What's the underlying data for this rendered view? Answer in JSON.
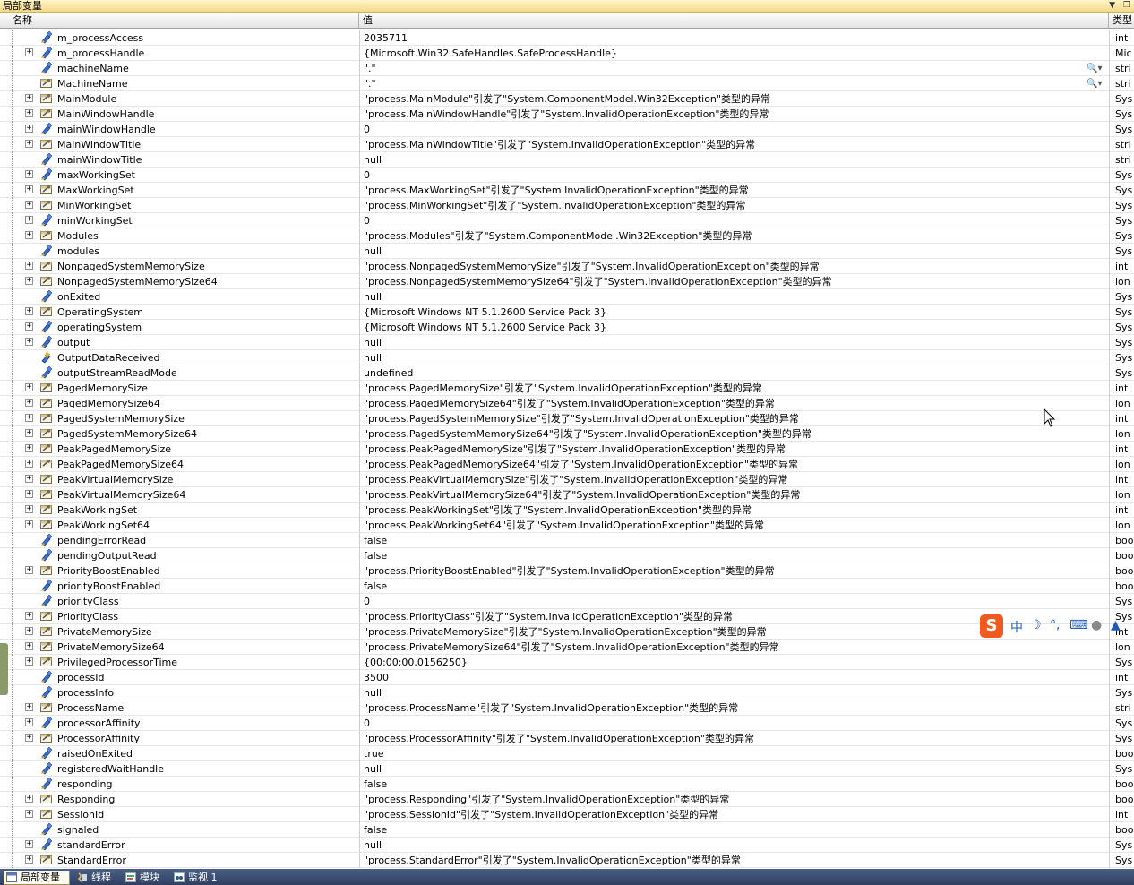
{
  "panel": {
    "title": "局部变量"
  },
  "columns": {
    "name": "名称",
    "value": "值",
    "type": "类型"
  },
  "rows": [
    {
      "name": "m_processAccess",
      "value": "2035711",
      "type": "int",
      "exp": false,
      "icon": "field"
    },
    {
      "name": "m_processHandle",
      "value": "{Microsoft.Win32.SafeHandles.SafeProcessHandle}",
      "type": "Mic",
      "exp": true,
      "icon": "field"
    },
    {
      "name": "machineName",
      "value": "\".\"",
      "type": "stri",
      "exp": false,
      "icon": "field",
      "mag": true
    },
    {
      "name": "MachineName",
      "value": "\".\"",
      "type": "stri",
      "exp": false,
      "icon": "prop",
      "mag": true
    },
    {
      "name": "MainModule",
      "value": "\"process.MainModule\"引发了\"System.ComponentModel.Win32Exception\"类型的异常",
      "type": "Sys",
      "exp": true,
      "icon": "prop"
    },
    {
      "name": "MainWindowHandle",
      "value": "\"process.MainWindowHandle\"引发了\"System.InvalidOperationException\"类型的异常",
      "type": "Sys",
      "exp": true,
      "icon": "prop"
    },
    {
      "name": "mainWindowHandle",
      "value": "0",
      "type": "Sys",
      "exp": true,
      "icon": "field"
    },
    {
      "name": "MainWindowTitle",
      "value": "\"process.MainWindowTitle\"引发了\"System.InvalidOperationException\"类型的异常",
      "type": "stri",
      "exp": true,
      "icon": "prop"
    },
    {
      "name": "mainWindowTitle",
      "value": "null",
      "type": "stri",
      "exp": false,
      "icon": "field"
    },
    {
      "name": "maxWorkingSet",
      "value": "0",
      "type": "Sys",
      "exp": true,
      "icon": "field"
    },
    {
      "name": "MaxWorkingSet",
      "value": "\"process.MaxWorkingSet\"引发了\"System.InvalidOperationException\"类型的异常",
      "type": "Sys",
      "exp": true,
      "icon": "prop"
    },
    {
      "name": "MinWorkingSet",
      "value": "\"process.MinWorkingSet\"引发了\"System.InvalidOperationException\"类型的异常",
      "type": "Sys",
      "exp": true,
      "icon": "prop"
    },
    {
      "name": "minWorkingSet",
      "value": "0",
      "type": "Sys",
      "exp": true,
      "icon": "field"
    },
    {
      "name": "Modules",
      "value": "\"process.Modules\"引发了\"System.ComponentModel.Win32Exception\"类型的异常",
      "type": "Sys",
      "exp": true,
      "icon": "prop"
    },
    {
      "name": "modules",
      "value": "null",
      "type": "Sys",
      "exp": false,
      "icon": "field"
    },
    {
      "name": "NonpagedSystemMemorySize",
      "value": "\"process.NonpagedSystemMemorySize\"引发了\"System.InvalidOperationException\"类型的异常",
      "type": "int",
      "exp": true,
      "icon": "prop"
    },
    {
      "name": "NonpagedSystemMemorySize64",
      "value": "\"process.NonpagedSystemMemorySize64\"引发了\"System.InvalidOperationException\"类型的异常",
      "type": "lon",
      "exp": true,
      "icon": "prop"
    },
    {
      "name": "onExited",
      "value": "null",
      "type": "Sys",
      "exp": false,
      "icon": "field"
    },
    {
      "name": "OperatingSystem",
      "value": "{Microsoft Windows NT 5.1.2600 Service Pack 3}",
      "type": "Sys",
      "exp": true,
      "icon": "prop"
    },
    {
      "name": "operatingSystem",
      "value": "{Microsoft Windows NT 5.1.2600 Service Pack 3}",
      "type": "Sys",
      "exp": true,
      "icon": "field"
    },
    {
      "name": "output",
      "value": "null",
      "type": "Sys",
      "exp": true,
      "icon": "field"
    },
    {
      "name": "OutputDataReceived",
      "value": "null",
      "type": "Sys",
      "exp": false,
      "icon": "event"
    },
    {
      "name": "outputStreamReadMode",
      "value": "undefined",
      "type": "Sys",
      "exp": false,
      "icon": "field"
    },
    {
      "name": "PagedMemorySize",
      "value": "\"process.PagedMemorySize\"引发了\"System.InvalidOperationException\"类型的异常",
      "type": "int",
      "exp": true,
      "icon": "prop"
    },
    {
      "name": "PagedMemorySize64",
      "value": "\"process.PagedMemorySize64\"引发了\"System.InvalidOperationException\"类型的异常",
      "type": "lon",
      "exp": true,
      "icon": "prop"
    },
    {
      "name": "PagedSystemMemorySize",
      "value": "\"process.PagedSystemMemorySize\"引发了\"System.InvalidOperationException\"类型的异常",
      "type": "int",
      "exp": true,
      "icon": "prop"
    },
    {
      "name": "PagedSystemMemorySize64",
      "value": "\"process.PagedSystemMemorySize64\"引发了\"System.InvalidOperationException\"类型的异常",
      "type": "lon",
      "exp": true,
      "icon": "prop"
    },
    {
      "name": "PeakPagedMemorySize",
      "value": "\"process.PeakPagedMemorySize\"引发了\"System.InvalidOperationException\"类型的异常",
      "type": "int",
      "exp": true,
      "icon": "prop"
    },
    {
      "name": "PeakPagedMemorySize64",
      "value": "\"process.PeakPagedMemorySize64\"引发了\"System.InvalidOperationException\"类型的异常",
      "type": "lon",
      "exp": true,
      "icon": "prop"
    },
    {
      "name": "PeakVirtualMemorySize",
      "value": "\"process.PeakVirtualMemorySize\"引发了\"System.InvalidOperationException\"类型的异常",
      "type": "int",
      "exp": true,
      "icon": "prop"
    },
    {
      "name": "PeakVirtualMemorySize64",
      "value": "\"process.PeakVirtualMemorySize64\"引发了\"System.InvalidOperationException\"类型的异常",
      "type": "lon",
      "exp": true,
      "icon": "prop"
    },
    {
      "name": "PeakWorkingSet",
      "value": "\"process.PeakWorkingSet\"引发了\"System.InvalidOperationException\"类型的异常",
      "type": "int",
      "exp": true,
      "icon": "prop"
    },
    {
      "name": "PeakWorkingSet64",
      "value": "\"process.PeakWorkingSet64\"引发了\"System.InvalidOperationException\"类型的异常",
      "type": "lon",
      "exp": true,
      "icon": "prop"
    },
    {
      "name": "pendingErrorRead",
      "value": "false",
      "type": "boo",
      "exp": false,
      "icon": "field"
    },
    {
      "name": "pendingOutputRead",
      "value": "false",
      "type": "boo",
      "exp": false,
      "icon": "field"
    },
    {
      "name": "PriorityBoostEnabled",
      "value": "\"process.PriorityBoostEnabled\"引发了\"System.InvalidOperationException\"类型的异常",
      "type": "boo",
      "exp": true,
      "icon": "prop"
    },
    {
      "name": "priorityBoostEnabled",
      "value": "false",
      "type": "boo",
      "exp": false,
      "icon": "field"
    },
    {
      "name": "priorityClass",
      "value": "0",
      "type": "Sys",
      "exp": false,
      "icon": "field"
    },
    {
      "name": "PriorityClass",
      "value": "\"process.PriorityClass\"引发了\"System.InvalidOperationException\"类型的异常",
      "type": "Sys",
      "exp": true,
      "icon": "prop"
    },
    {
      "name": "PrivateMemorySize",
      "value": "\"process.PrivateMemorySize\"引发了\"System.InvalidOperationException\"类型的异常",
      "type": "int",
      "exp": true,
      "icon": "prop"
    },
    {
      "name": "PrivateMemorySize64",
      "value": "\"process.PrivateMemorySize64\"引发了\"System.InvalidOperationException\"类型的异常",
      "type": "lon",
      "exp": true,
      "icon": "prop"
    },
    {
      "name": "PrivilegedProcessorTime",
      "value": "{00:00:00.0156250}",
      "type": "Sys",
      "exp": true,
      "icon": "prop"
    },
    {
      "name": "processId",
      "value": "3500",
      "type": "int",
      "exp": false,
      "icon": "field"
    },
    {
      "name": "processInfo",
      "value": "null",
      "type": "Sys",
      "exp": false,
      "icon": "field"
    },
    {
      "name": "ProcessName",
      "value": "\"process.ProcessName\"引发了\"System.InvalidOperationException\"类型的异常",
      "type": "stri",
      "exp": true,
      "icon": "prop"
    },
    {
      "name": "processorAffinity",
      "value": "0",
      "type": "Sys",
      "exp": true,
      "icon": "field"
    },
    {
      "name": "ProcessorAffinity",
      "value": "\"process.ProcessorAffinity\"引发了\"System.InvalidOperationException\"类型的异常",
      "type": "Sys",
      "exp": true,
      "icon": "prop"
    },
    {
      "name": "raisedOnExited",
      "value": "true",
      "type": "boo",
      "exp": false,
      "icon": "field"
    },
    {
      "name": "registeredWaitHandle",
      "value": "null",
      "type": "Sys",
      "exp": false,
      "icon": "field"
    },
    {
      "name": "responding",
      "value": "false",
      "type": "boo",
      "exp": false,
      "icon": "field"
    },
    {
      "name": "Responding",
      "value": "\"process.Responding\"引发了\"System.InvalidOperationException\"类型的异常",
      "type": "boo",
      "exp": true,
      "icon": "prop"
    },
    {
      "name": "SessionId",
      "value": "\"process.SessionId\"引发了\"System.InvalidOperationException\"类型的异常",
      "type": "int",
      "exp": true,
      "icon": "prop"
    },
    {
      "name": "signaled",
      "value": "false",
      "type": "boo",
      "exp": false,
      "icon": "field"
    },
    {
      "name": "standardError",
      "value": "null",
      "type": "Sys",
      "exp": true,
      "icon": "field"
    },
    {
      "name": "StandardError",
      "value": "\"process.StandardError\"引发了\"System.InvalidOperationException\"类型的异常",
      "type": "Sys",
      "exp": true,
      "icon": "prop"
    }
  ],
  "bottom_tabs": [
    {
      "label": "局部变量",
      "active": true
    },
    {
      "label": "线程",
      "active": false
    },
    {
      "label": "模块",
      "active": false
    },
    {
      "label": "监视 1",
      "active": false
    }
  ],
  "ime_bar": {
    "mode": "中"
  },
  "colors": {
    "titlebar": "#f4d98a",
    "statusbar": "#2f3f62",
    "ime_logo": "#f05a1e"
  }
}
